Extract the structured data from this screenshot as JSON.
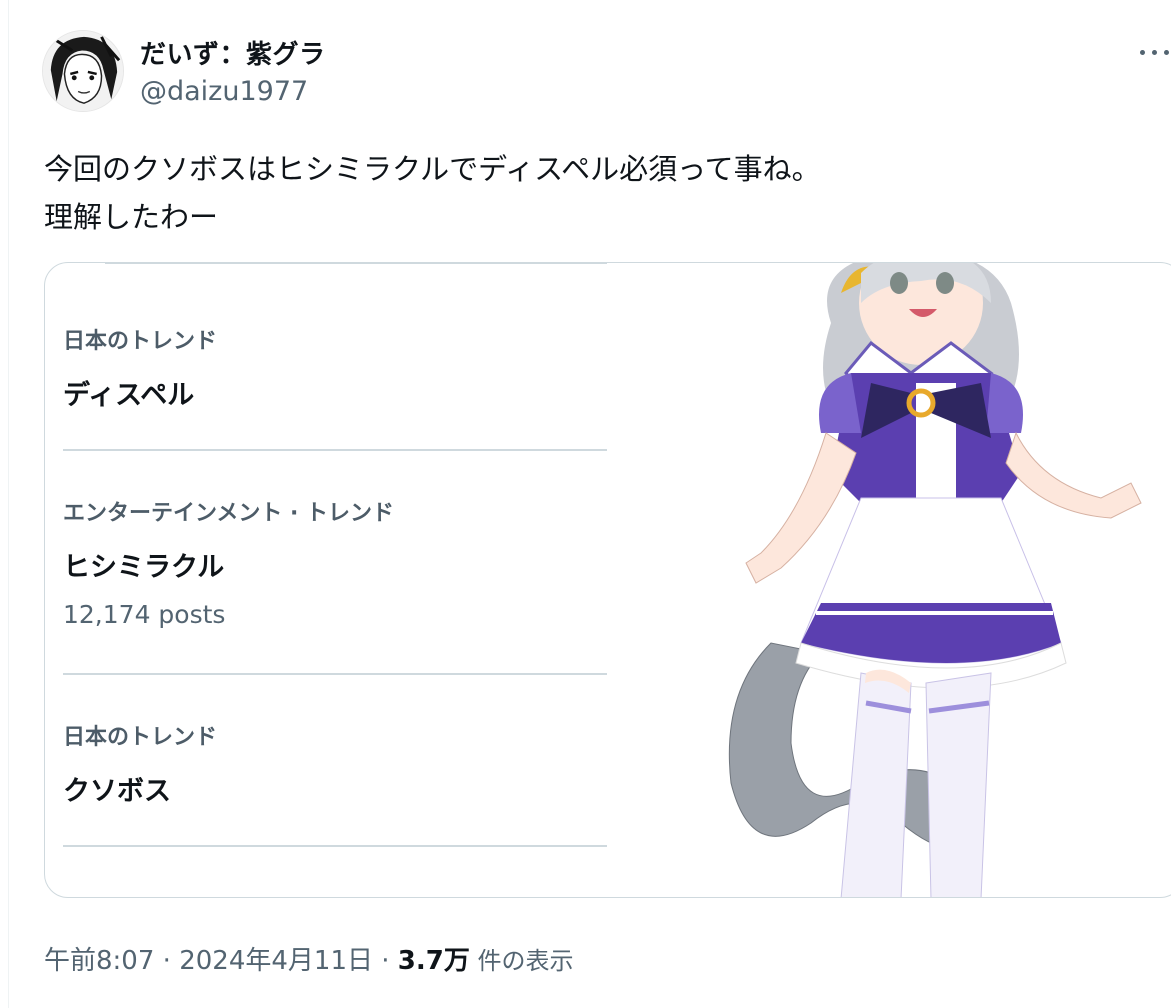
{
  "user": {
    "display_name": "だいず：紫グラ",
    "handle": "@daizu1977"
  },
  "tweet": {
    "lines": [
      "今回のクソボスはヒシミラクルでディスペル必須って事ね。",
      "理解したわー"
    ]
  },
  "trends": [
    {
      "category": "日本のトレンド",
      "name": "ディスペル",
      "count": ""
    },
    {
      "category": "エンターテインメント · トレンド",
      "name": "ヒシミラクル",
      "count": "12,174 posts"
    },
    {
      "category": "日本のトレンド",
      "name": "クソボス",
      "count": ""
    }
  ],
  "meta": {
    "time": "午前8:07",
    "sep1": " · ",
    "date": "2024年4月11日",
    "sep2": " · ",
    "views_count": "3.7万",
    "views_label": " 件の表示"
  },
  "icons": {
    "avatar": "avatar-manga-portrait",
    "more": "more-horizontal-icon"
  },
  "colors": {
    "text": "#0f1419",
    "secondary": "#536471",
    "border": "#cfd9de",
    "uniform_purple": "#5b3fb0"
  }
}
